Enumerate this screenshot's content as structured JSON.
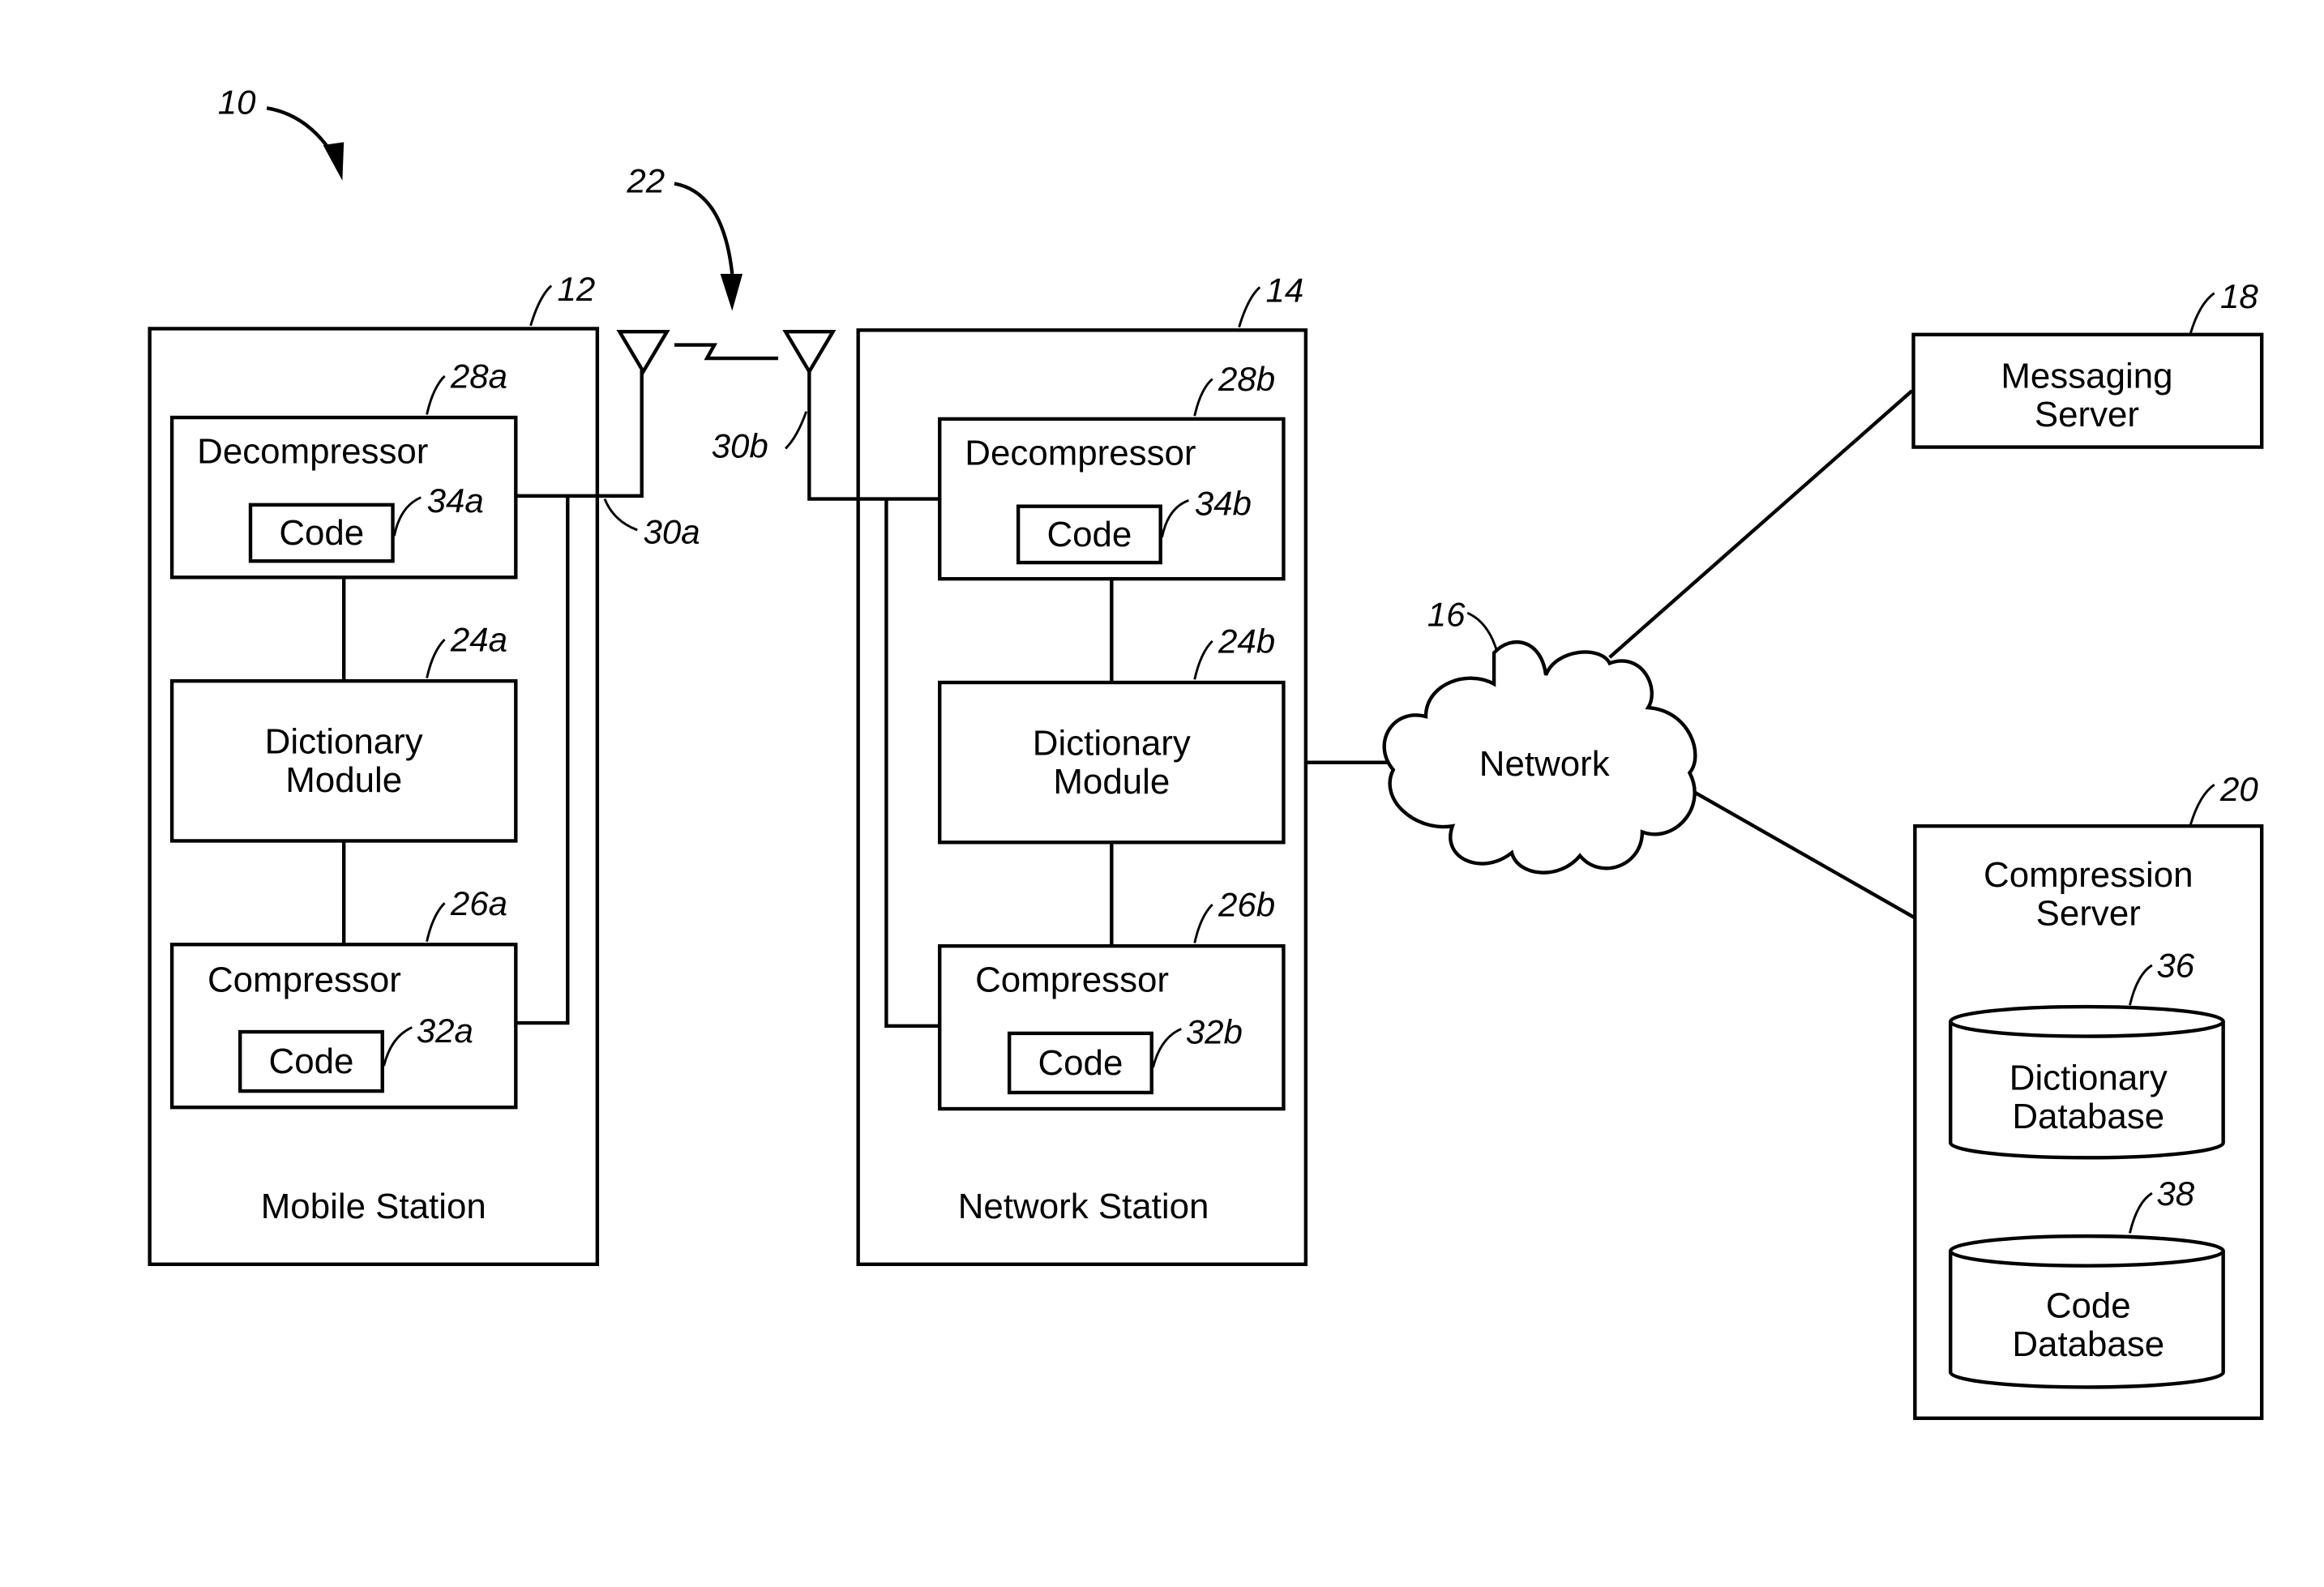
{
  "figure": {
    "ref": "10",
    "link_ref": "22"
  },
  "mobile_station": {
    "ref": "12",
    "label": "Mobile Station",
    "antenna_ref": "30a",
    "decompressor": {
      "ref": "28a",
      "label": "Decompressor",
      "code_ref": "34a",
      "code_label": "Code"
    },
    "dictionary": {
      "ref": "24a",
      "line1": "Dictionary",
      "line2": "Module"
    },
    "compressor": {
      "ref": "26a",
      "label": "Compressor",
      "code_ref": "32a",
      "code_label": "Code"
    }
  },
  "network_station": {
    "ref": "14",
    "label": "Network Station",
    "antenna_ref": "30b",
    "decompressor": {
      "ref": "28b",
      "label": "Decompressor",
      "code_ref": "34b",
      "code_label": "Code"
    },
    "dictionary": {
      "ref": "24b",
      "line1": "Dictionary",
      "line2": "Module"
    },
    "compressor": {
      "ref": "26b",
      "label": "Compressor",
      "code_ref": "32b",
      "code_label": "Code"
    }
  },
  "network": {
    "ref": "16",
    "label": "Network"
  },
  "messaging_server": {
    "ref": "18",
    "line1": "Messaging",
    "line2": "Server"
  },
  "compression_server": {
    "ref": "20",
    "line1": "Compression",
    "line2": "Server",
    "dictionary_db": {
      "ref": "36",
      "line1": "Dictionary",
      "line2": "Database"
    },
    "code_db": {
      "ref": "38",
      "line1": "Code",
      "line2": "Database"
    }
  }
}
